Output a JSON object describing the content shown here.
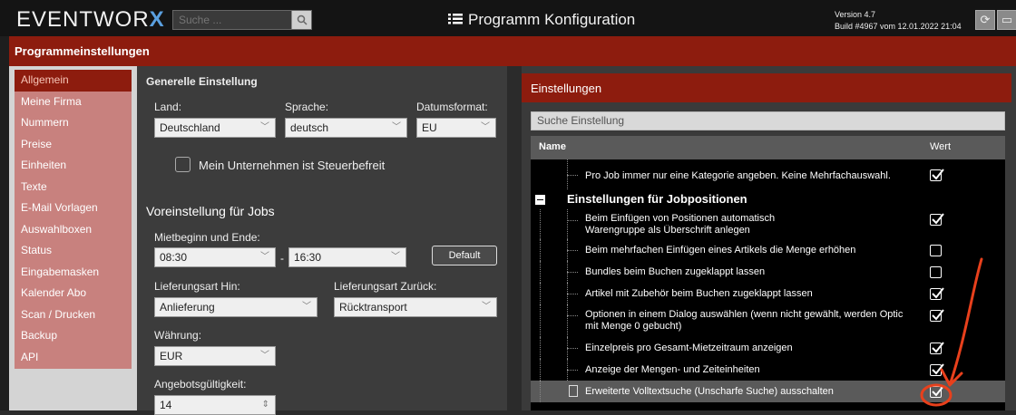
{
  "app": {
    "logo_text": "EVENTWOR",
    "logo_x": "X",
    "search_placeholder": "Suche ...",
    "title": "Programm Konfiguration",
    "version": "Version 4.7",
    "build": "Build #4967 vom 12.01.2022 21:04"
  },
  "page_title": "Programmeinstellungen",
  "sidebar": {
    "items": [
      {
        "label": "Allgemein",
        "active": true
      },
      {
        "label": "Meine Firma"
      },
      {
        "label": "Nummern"
      },
      {
        "label": "Preise"
      },
      {
        "label": "Einheiten"
      },
      {
        "label": "Texte"
      },
      {
        "label": "E-Mail Vorlagen"
      },
      {
        "label": "Auswahlboxen"
      },
      {
        "label": "Status"
      },
      {
        "label": "Eingabemasken"
      },
      {
        "label": "Kalender Abo"
      },
      {
        "label": "Scan / Drucken"
      },
      {
        "label": "Backup"
      },
      {
        "label": "API"
      }
    ]
  },
  "general": {
    "heading": "Generelle Einstellung",
    "land_label": "Land:",
    "land_value": "Deutschland",
    "sprache_label": "Sprache:",
    "sprache_value": "deutsch",
    "datum_label": "Datumsformat:",
    "datum_value": "EU",
    "tax_label": "Mein Unternehmen ist Steuerbefreit"
  },
  "jobs": {
    "heading": "Voreinstellung für Jobs",
    "miet_label": "Mietbeginn und Ende:",
    "start_value": "08:30",
    "dash": "-",
    "end_value": "16:30",
    "default_button": "Default",
    "hin_label": "Lieferungsart Hin:",
    "hin_value": "Anlieferung",
    "zurueck_label": "Lieferungsart Zurück:",
    "zurueck_value": "Rücktransport",
    "waehrung_label": "Währung:",
    "waehrung_value": "EUR",
    "angebot_label": "Angebotsgültigkeit:",
    "angebot_value": "14"
  },
  "settings": {
    "heading": "Einstellungen",
    "search_placeholder": "Suche Einstellung",
    "col_name": "Name",
    "col_value": "Wert",
    "row0": {
      "text": "Pro Job immer nur eine Kategorie angeben. Keine Mehrfachauswahl.",
      "checked": true
    },
    "group": "Einstellungen für Jobpositionen",
    "row1": {
      "line1": "Beim Einfügen von Positionen automatisch",
      "line2": "Warengruppe als Überschrift anlegen",
      "checked": true
    },
    "row2": {
      "text": "Beim mehrfachen Einfügen eines Artikels die Menge erhöhen",
      "checked": false
    },
    "row3": {
      "text": "Bundles beim Buchen zugeklappt lassen",
      "checked": false
    },
    "row4": {
      "text": "Artikel mit Zubehör beim Buchen zugeklappt lassen",
      "checked": true
    },
    "row5": {
      "line1": "Optionen in einem Dialog auswählen (wenn nicht gewählt, werden Optic",
      "line2": "mit Menge 0 gebucht)",
      "checked": true
    },
    "row6": {
      "text": "Einzelpreis pro Gesamt-Mietzeitraum anzeigen",
      "checked": true
    },
    "row7": {
      "text": "Anzeige der Mengen- und Zeiteinheiten",
      "checked": true
    },
    "row8": {
      "text": "Erweiterte Volltextsuche (Unscharfe Suche) ausschalten",
      "checked": true
    }
  },
  "colors": {
    "accent_red": "#8d1c0e",
    "annotation": "#e8401c"
  }
}
